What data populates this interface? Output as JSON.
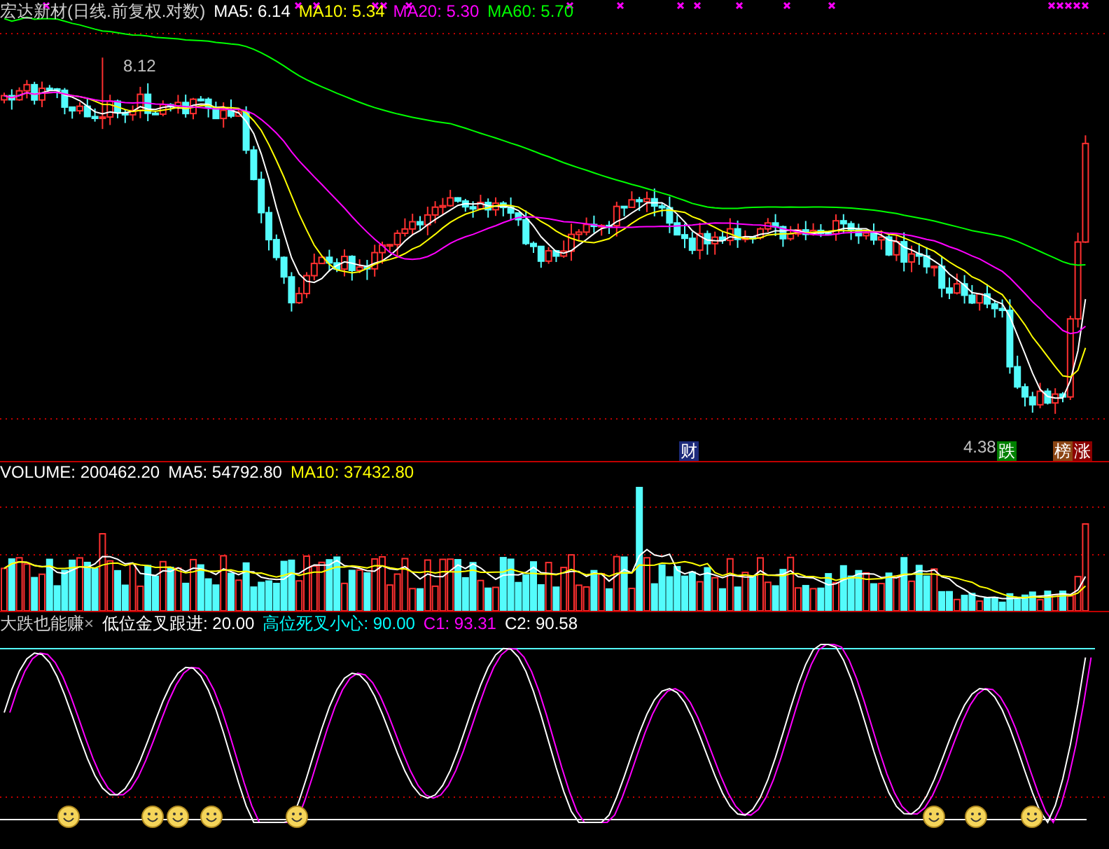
{
  "price_panel": {
    "title": "宏达新材(日线.前复权.对数)",
    "ma": [
      {
        "label": "MA5: 6.14",
        "color": "#ffffff"
      },
      {
        "label": "MA10: 5.34",
        "color": "#ffff00"
      },
      {
        "label": "MA20: 5.30",
        "color": "#ff00ff"
      },
      {
        "label": "MA60: 5.70",
        "color": "#00ff00"
      }
    ],
    "labels": [
      {
        "kind": "price",
        "text": "8.12"
      },
      {
        "kind": "badge",
        "text": "财",
        "color": "#1c2a7a"
      },
      {
        "kind": "price",
        "text": "4.38"
      },
      {
        "kind": "badge",
        "text": "跌",
        "color": "#008000"
      },
      {
        "kind": "badge",
        "text": "榜",
        "color": "#8b4513"
      },
      {
        "kind": "badge",
        "text": "涨",
        "color": "#8b0000"
      }
    ]
  },
  "volume_panel": {
    "items": [
      {
        "label": "VOLUME: 200462.20",
        "color": "#ffffff"
      },
      {
        "label": "MA5: 54792.80",
        "color": "#ffffff"
      },
      {
        "label": "MA10: 37432.80",
        "color": "#ffff00"
      }
    ]
  },
  "indicator_panel": {
    "title": "大跌也能赚",
    "close": "×",
    "items": [
      {
        "label": "低位金叉跟进: 20.00",
        "color": "#ffffff"
      },
      {
        "label": "高位死叉小心: 90.00",
        "color": "#00ffff"
      },
      {
        "label": "C1: 93.31",
        "color": "#ff00ff"
      },
      {
        "label": "C2: 90.58",
        "color": "#ffffff"
      }
    ]
  }
}
